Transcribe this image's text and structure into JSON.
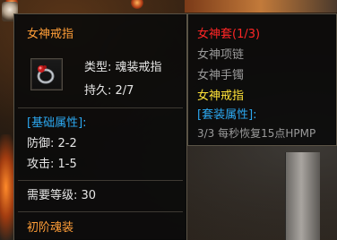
{
  "item": {
    "name": "女神戒指",
    "type_label": "类型",
    "type_value": "魂装戒指",
    "durability_label": "持久",
    "durability_value": "2/7",
    "basic_attr_header": "[基础属性]:",
    "defense_label": "防御",
    "defense_value": "2-2",
    "attack_label": "攻击",
    "attack_value": "1-5",
    "required_level_label": "需要等级",
    "required_level_value": "30",
    "grade": "初阶魂装",
    "icon": "ring-icon"
  },
  "set": {
    "title": "女神套(1/3)",
    "items": [
      {
        "name": "女神项链",
        "owned": false
      },
      {
        "name": "女神手镯",
        "owned": false
      },
      {
        "name": "女神戒指",
        "owned": true
      }
    ],
    "attr_header": "[套装属性]:",
    "bonus": "3/3 每秒恢复15点HPMP"
  },
  "colors": {
    "item_name": "#ff9e38",
    "set_title": "#ff2626",
    "owned": "#ffe238",
    "not_owned": "#9a9a9a",
    "attr_header": "#2ca8f0",
    "body_text": "#e6e6e6"
  }
}
